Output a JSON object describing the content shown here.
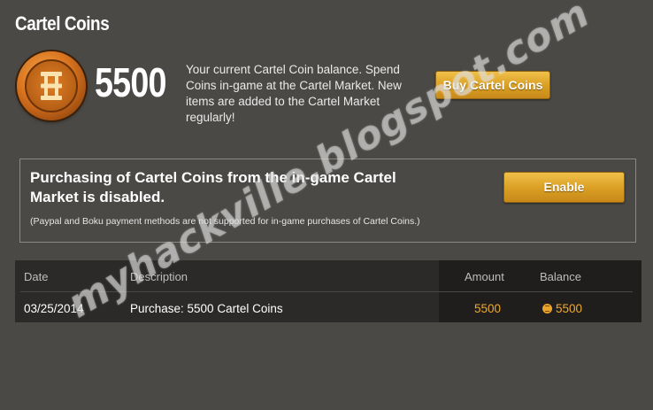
{
  "page": {
    "title": "Cartel Coins"
  },
  "balance": {
    "amount": "5500",
    "description": "Your current Cartel Coin balance. Spend Coins in-game at the Cartel Market. New items are added to the Cartel Market regularly!",
    "buy_button": "Buy Cartel Coins",
    "coin_icon": "cartel-coin-icon"
  },
  "notice": {
    "heading": "Purchasing of Cartel Coins from the in-game Cartel Market is disabled.",
    "subtext": "(Paypal and Boku payment methods are not supported for in-game purchases of Cartel Coins.)",
    "enable_button": "Enable"
  },
  "transactions": {
    "headers": {
      "date": "Date",
      "description": "Description",
      "amount": "Amount",
      "balance": "Balance"
    },
    "rows": [
      {
        "date": "03/25/2014",
        "description": "Purchase: 5500 Cartel Coins",
        "amount": "5500",
        "balance": "5500"
      }
    ]
  },
  "watermark": "myhackville.blogspot.com",
  "colors": {
    "background": "#4a4946",
    "accent": "#f2a92c",
    "button": "#d99e22"
  }
}
